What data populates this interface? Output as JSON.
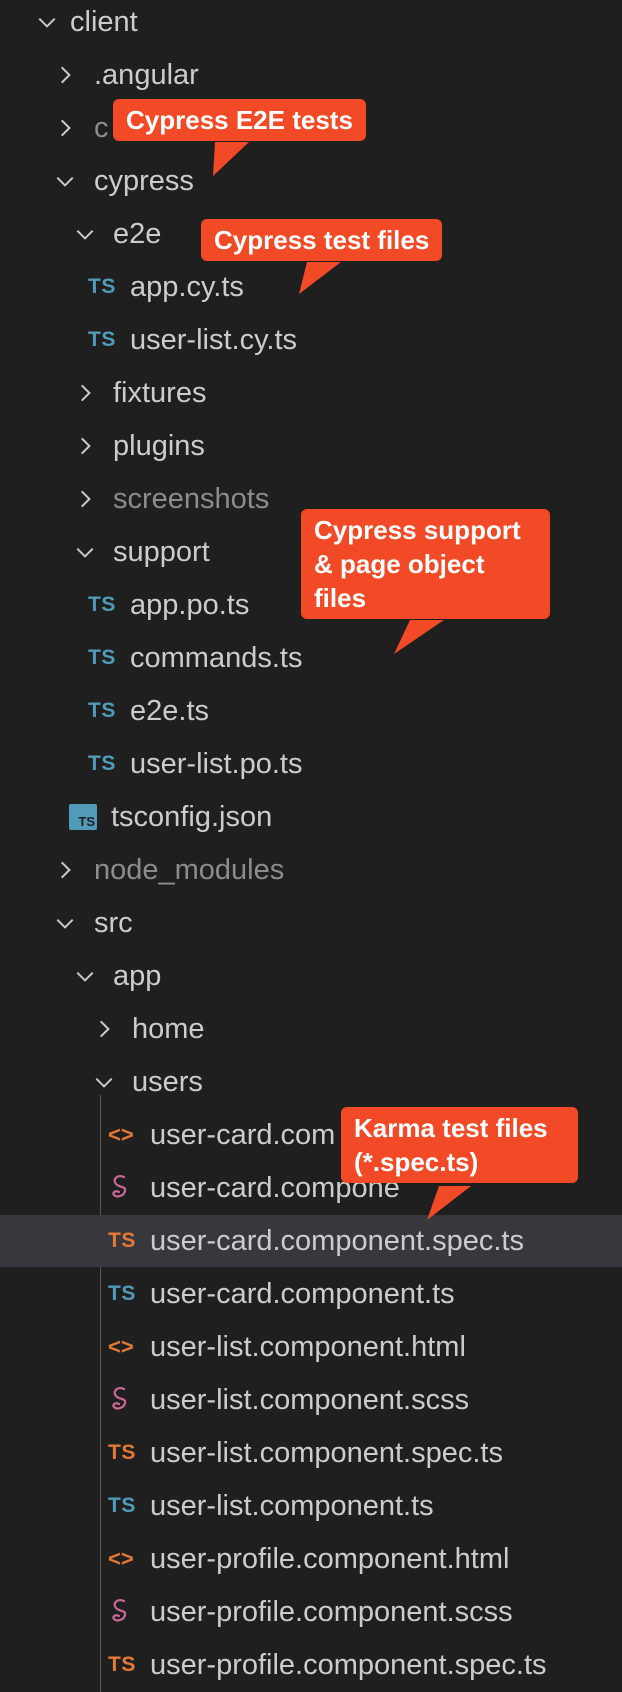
{
  "tree": {
    "rows": [
      {
        "label": "client",
        "type": "folder",
        "expanded": true
      },
      {
        "label": ".angular",
        "type": "folder",
        "expanded": false
      },
      {
        "label": "c",
        "type": "folder",
        "expanded": false
      },
      {
        "label": "cypress",
        "type": "folder",
        "expanded": true
      },
      {
        "label": "e2e",
        "type": "folder",
        "expanded": true
      },
      {
        "label": "app.cy.ts",
        "type": "ts",
        "icon_text": "TS"
      },
      {
        "label": "user-list.cy.ts",
        "type": "ts",
        "icon_text": "TS"
      },
      {
        "label": "fixtures",
        "type": "folder",
        "expanded": false
      },
      {
        "label": "plugins",
        "type": "folder",
        "expanded": false
      },
      {
        "label": "screenshots",
        "type": "folder",
        "expanded": false
      },
      {
        "label": "support",
        "type": "folder",
        "expanded": true
      },
      {
        "label": "app.po.ts",
        "type": "ts",
        "icon_text": "TS"
      },
      {
        "label": "commands.ts",
        "type": "ts",
        "icon_text": "TS"
      },
      {
        "label": "e2e.ts",
        "type": "ts",
        "icon_text": "TS"
      },
      {
        "label": "user-list.po.ts",
        "type": "ts",
        "icon_text": "TS"
      },
      {
        "label": "tsconfig.json",
        "type": "tsconfig",
        "icon_text": "TS"
      },
      {
        "label": "node_modules",
        "type": "folder",
        "expanded": false
      },
      {
        "label": "src",
        "type": "folder",
        "expanded": true
      },
      {
        "label": "app",
        "type": "folder",
        "expanded": true
      },
      {
        "label": "home",
        "type": "folder",
        "expanded": false
      },
      {
        "label": "users",
        "type": "folder",
        "expanded": true
      },
      {
        "label": "user-card.com",
        "type": "html",
        "icon_text": "<>"
      },
      {
        "label": "user-card.compone",
        "type": "scss"
      },
      {
        "label": "user-card.component.spec.ts",
        "type": "spec",
        "icon_text": "TS"
      },
      {
        "label": "user-card.component.ts",
        "type": "ts",
        "icon_text": "TS"
      },
      {
        "label": "user-list.component.html",
        "type": "html",
        "icon_text": "<>"
      },
      {
        "label": "user-list.component.scss",
        "type": "scss"
      },
      {
        "label": "user-list.component.spec.ts",
        "type": "spec",
        "icon_text": "TS"
      },
      {
        "label": "user-list.component.ts",
        "type": "ts",
        "icon_text": "TS"
      },
      {
        "label": "user-profile.component.html",
        "type": "html",
        "icon_text": "<>"
      },
      {
        "label": "user-profile.component.scss",
        "type": "scss"
      },
      {
        "label": "user-profile.component.spec.ts",
        "type": "spec",
        "icon_text": "TS"
      }
    ]
  },
  "callouts": {
    "e2e": "Cypress E2E tests",
    "test_files": "Cypress test files",
    "support": "Cypress support & page object files",
    "karma": "Karma test files (*.spec.ts)"
  },
  "colors": {
    "background": "#1f1f1f",
    "selected_row": "#37373d",
    "ts_blue": "#519aba",
    "ts_orange": "#e37933",
    "scss_pink": "#cd6799",
    "callout": "#f24a26"
  }
}
